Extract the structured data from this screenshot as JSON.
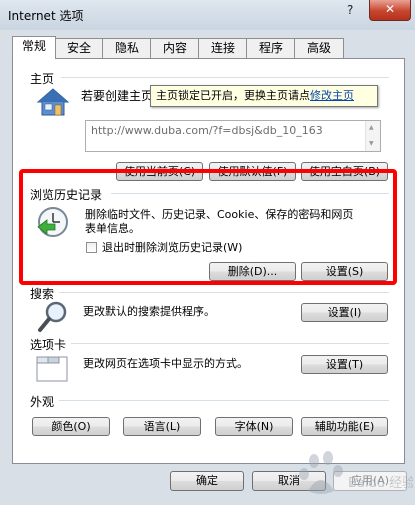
{
  "window": {
    "title": "Internet 选项",
    "help": "?",
    "close": "✕"
  },
  "tabs": [
    "常规",
    "安全",
    "隐私",
    "内容",
    "连接",
    "程序",
    "高级"
  ],
  "homepage": {
    "label": "主页",
    "desc": "若要创建主页选项卡，请在各自行键入地址",
    "url": "http://www.duba.com/?f=dbsj&db_10_163",
    "buttons": [
      "使用当前页(C)",
      "使用默认值(F)",
      "使用空白页(B)"
    ],
    "tooltip_text": "主页锁定已开启，更换主页请点",
    "tooltip_link": "修改主页"
  },
  "history": {
    "label": "浏览历史记录",
    "desc_line1": "删除临时文件、历史记录、Cookie、保存的密码和网页",
    "desc_line2": "表单信息。",
    "checkbox": "退出时删除浏览历史记录(W)",
    "delete_btn": "删除(D)...",
    "settings_btn": "设置(S)"
  },
  "search": {
    "label": "搜索",
    "desc": "更改默认的搜索提供程序。",
    "settings_btn": "设置(I)"
  },
  "tabsec": {
    "label": "选项卡",
    "desc": "更改网页在选项卡中显示的方式。",
    "settings_btn": "设置(T)"
  },
  "appearance": {
    "label": "外观",
    "buttons": [
      "颜色(O)",
      "语言(L)",
      "字体(N)",
      "辅助功能(E)"
    ]
  },
  "footer": {
    "ok": "确定",
    "cancel": "取消",
    "apply": "应用(A)"
  },
  "watermark": "Baidu 经验",
  "colors": {
    "highlight": "#ff0000",
    "link": "#0645ad",
    "tooltip_bg": "#ffffe1"
  }
}
